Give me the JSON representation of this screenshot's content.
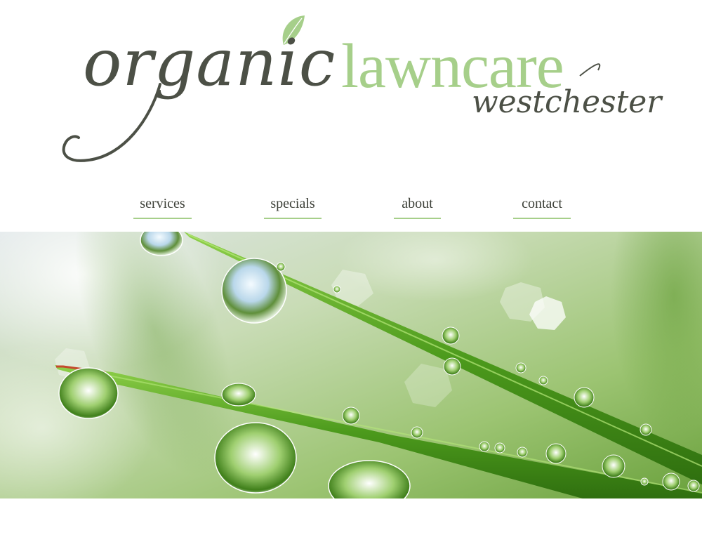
{
  "logo": {
    "word_organic": "organic",
    "word_lawncare": "lawncare",
    "word_westchester": "westchester",
    "leaf_icon": "leaf-icon"
  },
  "nav": {
    "items": [
      {
        "label": "services"
      },
      {
        "label": "specials"
      },
      {
        "label": "about"
      },
      {
        "label": "contact"
      }
    ]
  },
  "hero": {
    "image": "grass-dew-drops-photo"
  },
  "colors": {
    "brand_green": "#a6cf8a",
    "brand_dark": "#4c5046",
    "nav_text": "#3d4038",
    "background": "#ffffff"
  }
}
